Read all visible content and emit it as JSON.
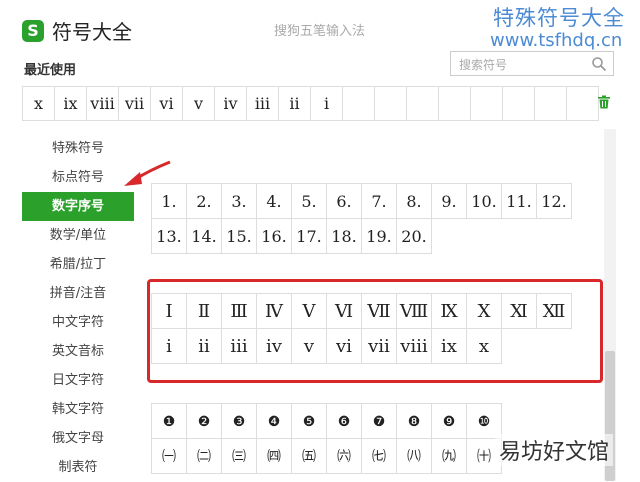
{
  "window": {
    "logo_letter": "S",
    "title": "符号大全",
    "subtitle": "搜狗五笔输入法"
  },
  "watermark": {
    "line1": "特殊符号大全",
    "line2": "www.tsfhdq.cn",
    "corner": "易坊好文馆"
  },
  "recent": {
    "label": "最近使用",
    "items": [
      "x",
      "ix",
      "viii",
      "vii",
      "vi",
      "v",
      "iv",
      "iii",
      "ii",
      "i",
      "",
      "",
      "",
      "",
      "",
      "",
      "",
      ""
    ]
  },
  "search": {
    "placeholder": "搜索符号"
  },
  "sidebar": {
    "items": [
      "特殊符号",
      "标点符号",
      "数字序号",
      "数学/单位",
      "希腊/拉丁",
      "拼音/注音",
      "中文字符",
      "英文音标",
      "日文字符",
      "韩文字符",
      "俄文字母",
      "制表符"
    ],
    "active_index": 2
  },
  "numbers": {
    "row1": [
      "1.",
      "2.",
      "3.",
      "4.",
      "5.",
      "6.",
      "7.",
      "8.",
      "9.",
      "10.",
      "11.",
      "12."
    ],
    "row2": [
      "13.",
      "14.",
      "15.",
      "16.",
      "17.",
      "18.",
      "19.",
      "20."
    ]
  },
  "roman": {
    "upper": [
      "Ⅰ",
      "Ⅱ",
      "Ⅲ",
      "Ⅳ",
      "Ⅴ",
      "Ⅵ",
      "Ⅶ",
      "Ⅷ",
      "Ⅸ",
      "Ⅹ",
      "Ⅺ",
      "Ⅻ"
    ],
    "lower": [
      "ⅰ",
      "ⅱ",
      "ⅲ",
      "ⅳ",
      "ⅴ",
      "ⅵ",
      "ⅶ",
      "ⅷ",
      "ⅸ",
      "ⅹ"
    ]
  },
  "circled": {
    "row1": [
      "❶",
      "❷",
      "❸",
      "❹",
      "❺",
      "❻",
      "❼",
      "❽",
      "❾",
      "❿"
    ],
    "row2": [
      "㈠",
      "㈡",
      "㈢",
      "㈣",
      "㈤",
      "㈥",
      "㈦",
      "㈧",
      "㈨",
      "㈩"
    ]
  },
  "colors": {
    "accent": "#2ba12b",
    "highlight": "#d9282a",
    "watermark": "#4c8bd4"
  },
  "icons": {
    "search": "magnifier-icon",
    "delete": "trash-icon",
    "pointer": "red-arrow-icon"
  }
}
